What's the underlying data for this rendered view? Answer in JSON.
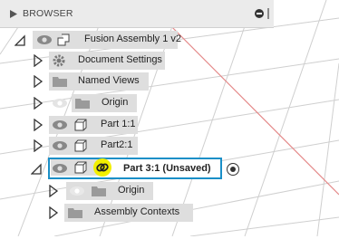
{
  "browser": {
    "title": "BROWSER"
  },
  "tree": {
    "root_label": "Fusion Assembly 1 v2",
    "document_settings": "Document Settings",
    "named_views": "Named Views",
    "origin_top": "Origin",
    "part1": "Part 1:1",
    "part2": "Part2:1",
    "part3": "Part 3:1 (Unsaved)",
    "origin_sub": "Origin",
    "assembly_contexts": "Assembly Contexts"
  },
  "colors": {
    "selection_border": "#1a8fc7",
    "link_highlight": "#f2ef00",
    "grid_line": "#cfcfcf",
    "red_axis": "#e48888"
  }
}
